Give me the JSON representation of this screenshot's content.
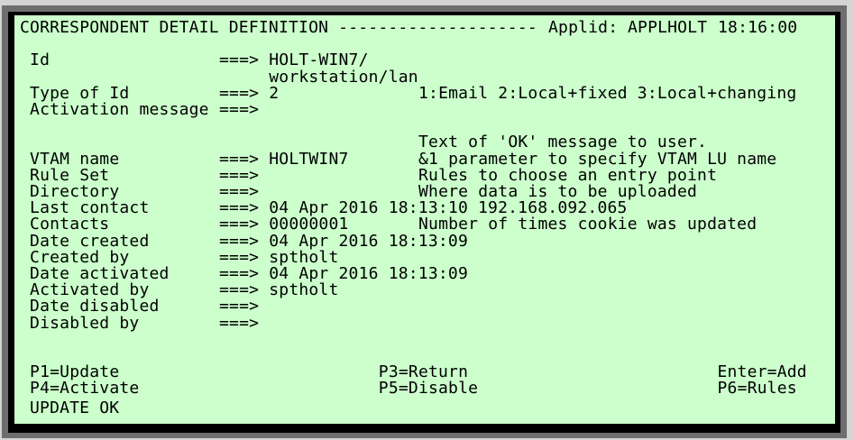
{
  "header": {
    "title": "CORRESPONDENT DETAIL DEFINITION --------------------",
    "applid_label": "Applid:",
    "applid": "APPLHOLT",
    "time": "18:16:00"
  },
  "arrow": "===>",
  "fields": [
    {
      "key": "id",
      "label": "Id",
      "value": "HOLT-WIN7/",
      "row": 2
    },
    {
      "key": "id-cont",
      "label": "",
      "value": "workstation/lan",
      "row": 3,
      "no_arrow": true
    },
    {
      "key": "type-of-id",
      "label": "Type of Id",
      "value": "2",
      "hint": "1:Email 2:Local+fixed 3:Local+changing",
      "row": 4
    },
    {
      "key": "activation-message",
      "label": "Activation message",
      "value": "",
      "row": 5
    },
    {
      "key": "activation-message-hint",
      "label": "",
      "value": "",
      "hint": "Text of 'OK' message to user.",
      "row": 7,
      "no_arrow": true
    },
    {
      "key": "vtam-name",
      "label": "VTAM name",
      "value": "HOLTWIN7",
      "hint": "&1 parameter to specify VTAM LU name",
      "row": 8
    },
    {
      "key": "rule-set",
      "label": "Rule Set",
      "value": "",
      "hint": "Rules to choose an entry point",
      "row": 9
    },
    {
      "key": "directory",
      "label": "Directory",
      "value": "",
      "hint": "Where data is to be uploaded",
      "row": 10
    },
    {
      "key": "last-contact",
      "label": "Last contact",
      "value": "04 Apr 2016 18:13:10 192.168.092.065",
      "row": 11
    },
    {
      "key": "contacts",
      "label": "Contacts",
      "value": "00000001",
      "hint": "Number of times cookie was updated",
      "row": 12
    },
    {
      "key": "date-created",
      "label": "Date created",
      "value": "04 Apr 2016 18:13:09",
      "row": 13
    },
    {
      "key": "created-by",
      "label": "Created by",
      "value": "sptholt",
      "row": 14
    },
    {
      "key": "date-activated",
      "label": "Date activated",
      "value": "04 Apr 2016 18:13:09",
      "row": 15
    },
    {
      "key": "activated-by",
      "label": "Activated by",
      "value": "sptholt",
      "row": 16
    },
    {
      "key": "date-disabled",
      "label": "Date disabled",
      "value": "",
      "row": 17
    },
    {
      "key": "disabled-by",
      "label": "Disabled by",
      "value": "",
      "row": 18
    }
  ],
  "pf_keys": [
    {
      "key": "p1",
      "label": "P1=Update",
      "row": 21,
      "col": 1
    },
    {
      "key": "p3",
      "label": "P3=Return",
      "row": 21,
      "col": 36
    },
    {
      "key": "enter",
      "label": "Enter=Add",
      "row": 21,
      "col": 70
    },
    {
      "key": "p4",
      "label": "P4=Activate",
      "row": 22,
      "col": 1
    },
    {
      "key": "p5",
      "label": "P5=Disable",
      "row": 22,
      "col": 36
    },
    {
      "key": "p6",
      "label": "P6=Rules",
      "row": 22,
      "col": 70
    }
  ],
  "status_message": "UPDATE OK",
  "colors": {
    "screen_bg": "#ccffcc",
    "text": "#000000"
  }
}
